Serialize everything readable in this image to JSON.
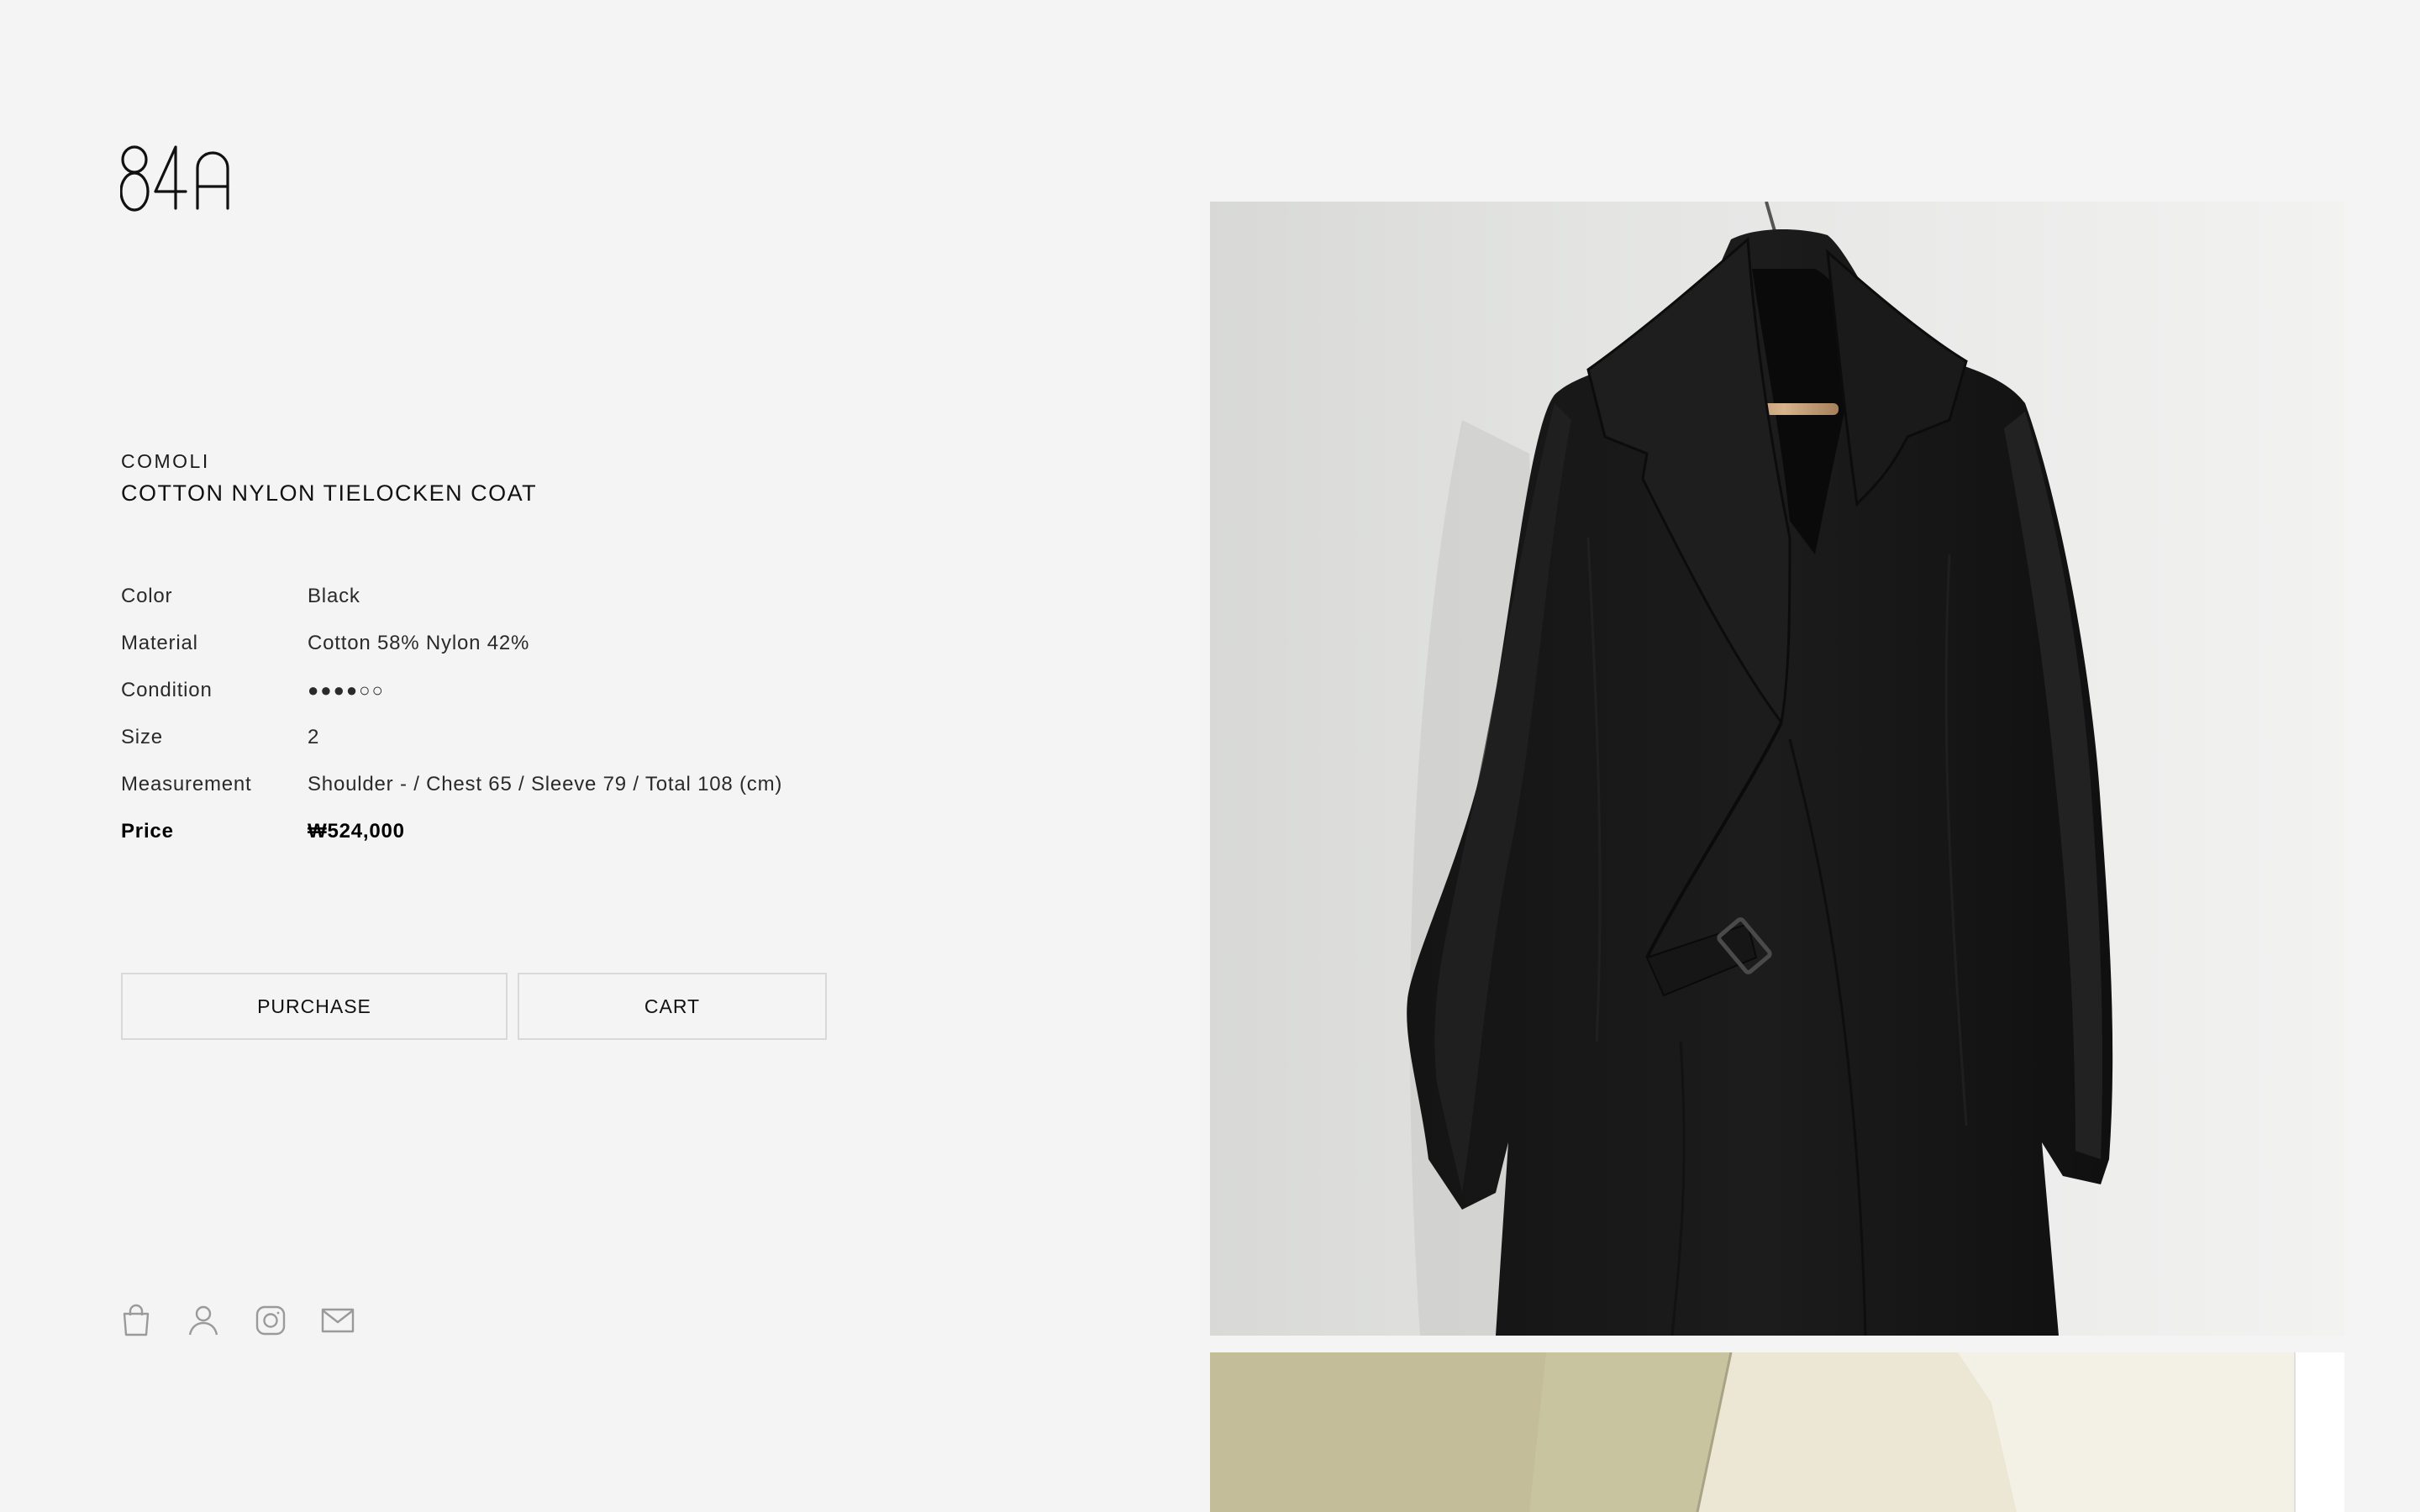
{
  "site": {
    "logo_text": "84A"
  },
  "product": {
    "brand": "COMOLI",
    "name": "COTTON NYLON TIELOCKEN COAT",
    "specs": [
      {
        "label": "Color",
        "value": "Black"
      },
      {
        "label": "Material",
        "value": "Cotton 58% Nylon 42%"
      },
      {
        "label": "Condition",
        "value": "●●●●○○"
      },
      {
        "label": "Size",
        "value": "2"
      },
      {
        "label": "Measurement",
        "value": "Shoulder - / Chest 65 / Sleeve 79 / Total 108 (cm)"
      }
    ],
    "price": {
      "label": "Price",
      "value": "₩524,000"
    },
    "condition_rating": {
      "filled": 4,
      "total": 6
    }
  },
  "actions": {
    "purchase_label": "PURCHASE",
    "cart_label": "CART"
  },
  "footer": {
    "icons": [
      "shopping-bag-icon",
      "user-icon",
      "instagram-icon",
      "mail-icon"
    ]
  },
  "colors": {
    "background": "#f4f4f4",
    "text": "#1a1a1a",
    "button_border": "#d9d9d9"
  }
}
